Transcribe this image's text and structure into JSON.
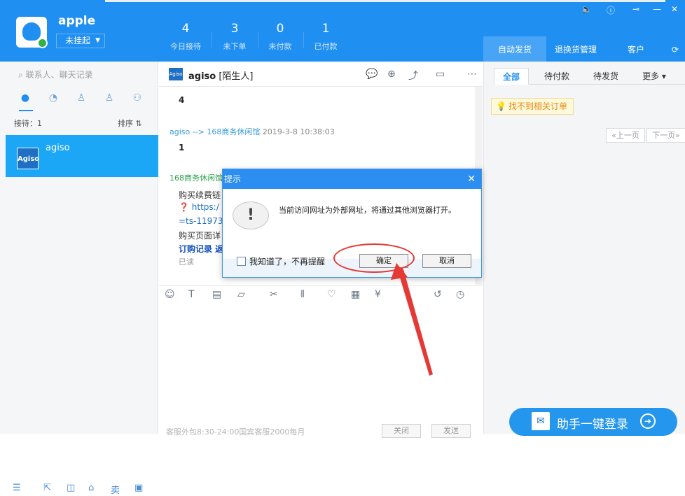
{
  "header": {
    "username": "apple",
    "status": "未挂起",
    "stats": [
      {
        "value": "4",
        "label": "今日接待"
      },
      {
        "value": "3",
        "label": "未下单"
      },
      {
        "value": "0",
        "label": "未付款"
      },
      {
        "value": "1",
        "label": "已付款"
      }
    ],
    "right_tabs": [
      "自动发货",
      "退换货管理",
      "客户"
    ]
  },
  "sidebar": {
    "search_placeholder": "联系人、聊天记录",
    "waiting_label": "接待：1",
    "sort_label": "排序 ⇅",
    "contact": {
      "avatar": "Agiso",
      "name": "agiso"
    }
  },
  "chat": {
    "name": "agiso",
    "tag": "[陌生人]",
    "messages": [
      {
        "body": "4"
      },
      {
        "meta": "agiso --> 168商务休闲馆",
        "time": "2019-3-8 10:38:03",
        "body": "1"
      }
    ],
    "partial": {
      "sender": "168商务休闲馆",
      "line1": "购买续费链",
      "link1": "https:/",
      "link2": "=ts-11973",
      "line2": "购买页面详",
      "line3": "订购记录 返",
      "read": "已读"
    },
    "footer_text": "客服外包8:30-24:00国宾客服2000每月",
    "close_btn": "关闭",
    "send_btn": "发送"
  },
  "right": {
    "filter_tabs": [
      "全部",
      "待付款",
      "待发货",
      "更多"
    ],
    "not_found": "找不到相关订单",
    "prev_page": "«上一页",
    "next_page": "下一页»",
    "one_key_login": "助手一键登录"
  },
  "dialog": {
    "title": "提示",
    "message": "当前访问网址为外部网址，将通过其他浏览器打开。",
    "checkbox_label": "我知道了，不再提醒",
    "ok": "确定",
    "cancel": "取消"
  }
}
